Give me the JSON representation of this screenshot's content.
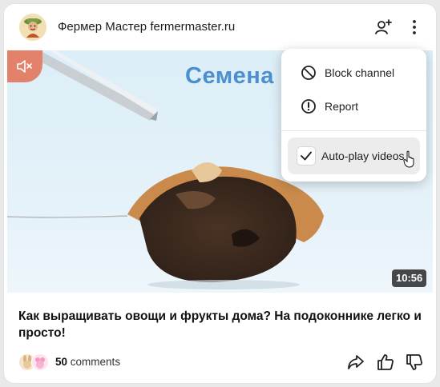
{
  "channel": {
    "name": "Фермер Мастер fermermaster.ru"
  },
  "video": {
    "overlay_text": "Семена",
    "duration": "10:56"
  },
  "menu": {
    "items": [
      {
        "label": "Block channel",
        "icon": "block-icon"
      },
      {
        "label": "Report",
        "icon": "report-icon"
      },
      {
        "label": "Auto-play videos",
        "icon": "check-icon",
        "checked": true
      }
    ]
  },
  "post": {
    "title": "Как выращивать овощи и фрукты дома? На подоконнике легко и просто!"
  },
  "footer": {
    "comment_count": "50",
    "comment_word": "comments",
    "icons": [
      "share-icon",
      "like-icon",
      "dislike-icon"
    ]
  },
  "colors": {
    "mute_button": "#e2826a",
    "video_text": "#4b8fcf",
    "menu_active_bg": "#ececec"
  }
}
